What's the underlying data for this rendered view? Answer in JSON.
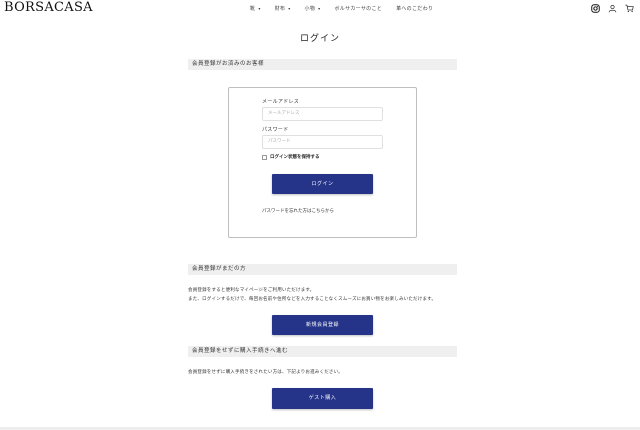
{
  "brand": {
    "logo": "BORSACASA",
    "accent": "#253489"
  },
  "nav": {
    "items": [
      {
        "label": "靴",
        "has_dropdown": true
      },
      {
        "label": "財布",
        "has_dropdown": true
      },
      {
        "label": "小物",
        "has_dropdown": true
      },
      {
        "label": "ボルサカーサのこと",
        "has_dropdown": false
      },
      {
        "label": "革へのこだわり",
        "has_dropdown": false
      }
    ],
    "caret": "▾"
  },
  "header_icons": [
    "instagram-icon",
    "user-icon",
    "cart-icon"
  ],
  "page": {
    "title": "ログイン"
  },
  "member": {
    "heading": "会員登録がお済みのお客様",
    "email_label": "メールアドレス",
    "email_placeholder": "メールアドレス",
    "password_label": "パスワード",
    "password_placeholder": "パスワード",
    "remember_label": "ログイン状態を保持する",
    "login_button": "ログイン",
    "forgot_link": "パスワードを忘れた方はこちらから"
  },
  "nonmember": {
    "heading": "会員登録がまだの方",
    "line1": "会員登録をすると便利なマイページをご利用いただけます。",
    "line2": "また、ログインするだけで、毎回お名前や住所などを入力することなくスムーズにお買い物をお楽しみいただけます。",
    "register_button": "新規会員登録"
  },
  "guest": {
    "heading": "会員登録をせずに購入手続きへ進む",
    "line1": "会員登録をせずに購入手続きをされたい方は、下記よりお進みください。",
    "guest_button": "ゲスト購入"
  }
}
